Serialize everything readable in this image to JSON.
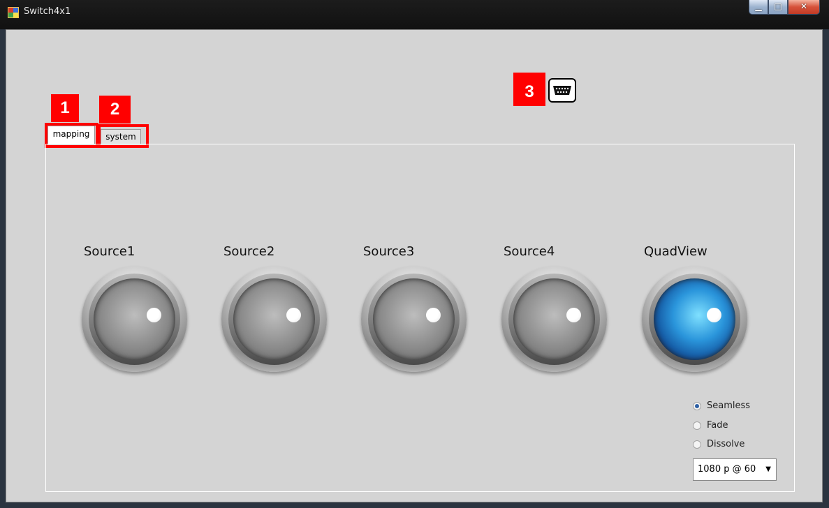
{
  "window": {
    "title": "Switch4x1",
    "controls": {
      "minimize_icon": "minimize-icon",
      "maximize_icon": "maximize-icon",
      "close_icon": "close-icon"
    }
  },
  "annotations": [
    {
      "number": "1"
    },
    {
      "number": "2"
    },
    {
      "number": "3"
    }
  ],
  "toolbar": {
    "serial_port_icon": "serial-port-icon"
  },
  "tabs": [
    {
      "label": "mapping",
      "selected": true
    },
    {
      "label": "system",
      "selected": false
    }
  ],
  "sources": [
    {
      "label": "Source1",
      "active": false
    },
    {
      "label": "Source2",
      "active": false
    },
    {
      "label": "Source3",
      "active": false
    },
    {
      "label": "Source4",
      "active": false
    },
    {
      "label": "QuadView",
      "active": true
    }
  ],
  "transition": {
    "options": [
      {
        "label": "Seamless",
        "checked": true
      },
      {
        "label": "Fade",
        "checked": false
      },
      {
        "label": "Dissolve",
        "checked": false
      }
    ]
  },
  "resolution": {
    "selected": "1080 p @ 60"
  },
  "colors": {
    "annotation": "#ff0000",
    "active_source": "#2a95db",
    "client_bg": "#d4d4d4"
  }
}
